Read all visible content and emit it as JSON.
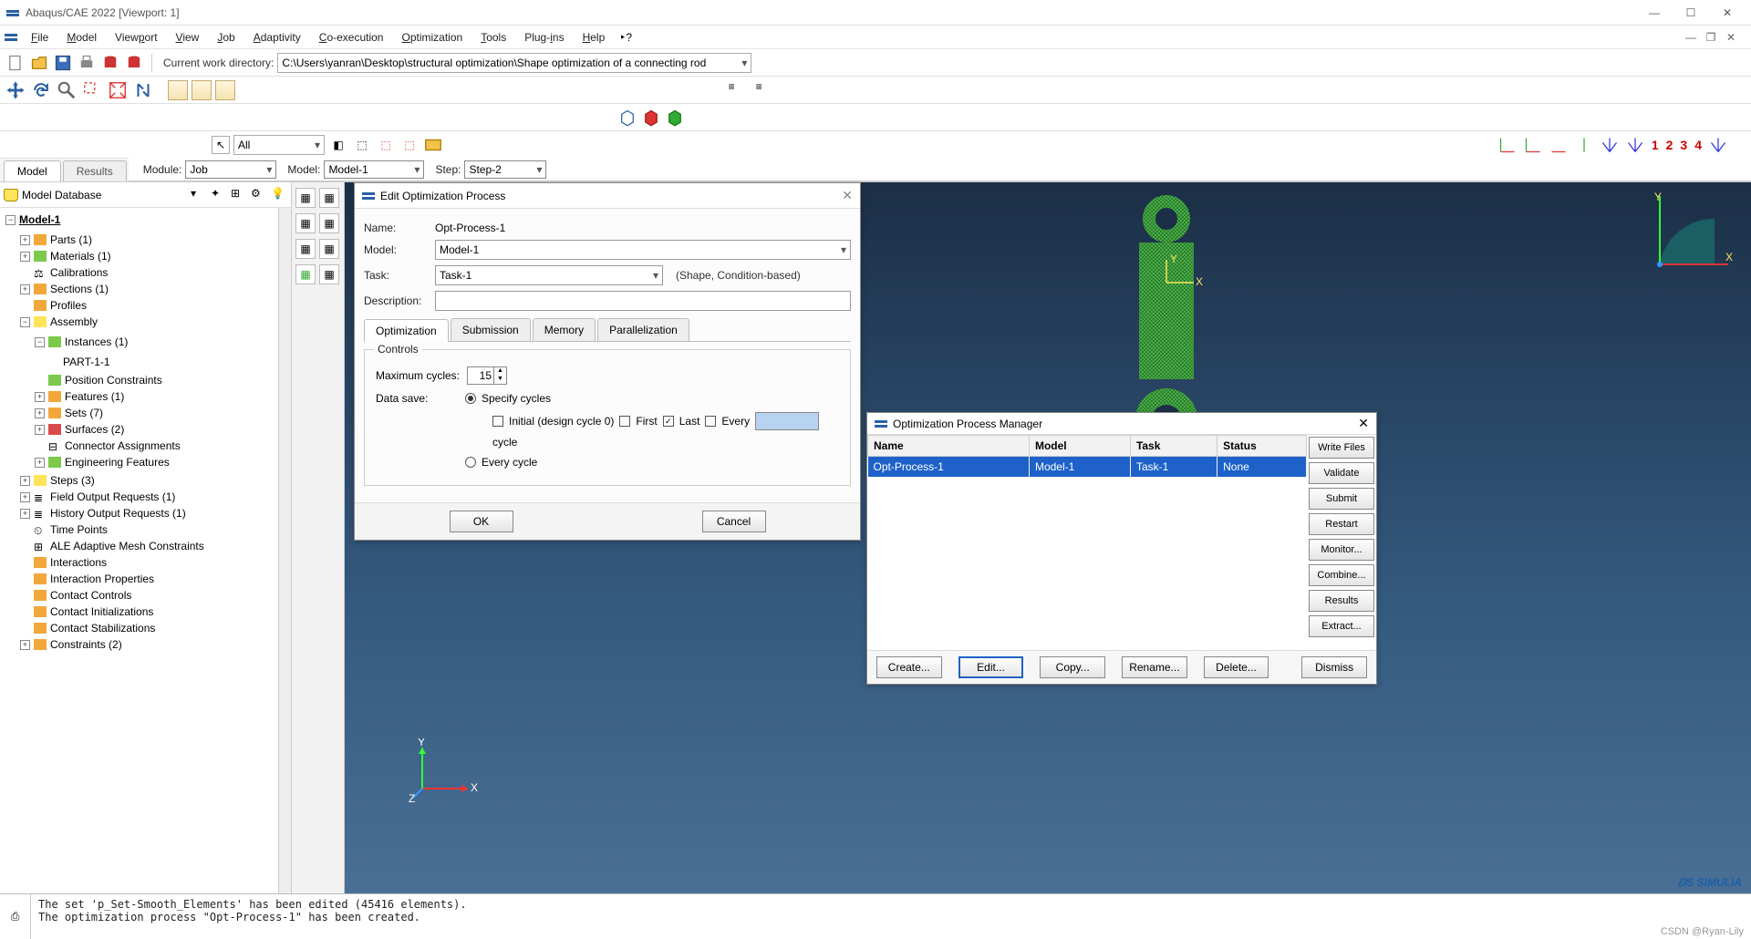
{
  "title": "Abaqus/CAE 2022 [Viewport: 1]",
  "menus": [
    "File",
    "Model",
    "Viewport",
    "View",
    "Job",
    "Adaptivity",
    "Co-execution",
    "Optimization",
    "Tools",
    "Plug-ins",
    "Help"
  ],
  "cwd_label": "Current work directory:",
  "cwd_path": "C:\\Users\\yanran\\Desktop\\structural optimization\\Shape optimization of a connecting rod",
  "sel_all": "All",
  "csys_nums": [
    "1",
    "2",
    "3",
    "4"
  ],
  "tabs": {
    "model": "Model",
    "results": "Results"
  },
  "module_row": {
    "module_label": "Module:",
    "module_value": "Job",
    "model_label": "Model:",
    "model_value": "Model-1",
    "step_label": "Step:",
    "step_value": "Step-2"
  },
  "db_label": "Model Database",
  "tree": {
    "root": "Model-1",
    "items": [
      "Parts (1)",
      "Materials (1)",
      "Calibrations",
      "Sections (1)",
      "Profiles",
      "Assembly",
      "Instances (1)",
      "PART-1-1",
      "Position Constraints",
      "Features (1)",
      "Sets (7)",
      "Surfaces (2)",
      "Connector Assignments",
      "Engineering Features",
      "Steps (3)",
      "Field Output Requests (1)",
      "History Output Requests (1)",
      "Time Points",
      "ALE Adaptive Mesh Constraints",
      "Interactions",
      "Interaction Properties",
      "Contact Controls",
      "Contact Initializations",
      "Contact Stabilizations",
      "Constraints (2)"
    ]
  },
  "edit_dialog": {
    "title": "Edit Optimization Process",
    "name_label": "Name:",
    "name_value": "Opt-Process-1",
    "model_label": "Model:",
    "model_value": "Model-1",
    "task_label": "Task:",
    "task_value": "Task-1",
    "task_note": "(Shape, Condition-based)",
    "desc_label": "Description:",
    "desc_value": "",
    "tabs": [
      "Optimization",
      "Submission",
      "Memory",
      "Parallelization"
    ],
    "controls_legend": "Controls",
    "max_cycles_label": "Maximum cycles:",
    "max_cycles_value": "15",
    "data_save_label": "Data save:",
    "specify_cycles": "Specify cycles",
    "initial_chk": "Initial (design cycle 0)",
    "first_chk": "First",
    "last_chk": "Last",
    "every_chk": "Every",
    "cycle_suffix": "cycle",
    "every_cycle": "Every cycle",
    "ok": "OK",
    "cancel": "Cancel"
  },
  "mgr_dialog": {
    "title": "Optimization Process Manager",
    "headers": [
      "Name",
      "Model",
      "Task",
      "Status"
    ],
    "row": [
      "Opt-Process-1",
      "Model-1",
      "Task-1",
      "None"
    ],
    "right_buttons": [
      "Write Files",
      "Validate",
      "Submit",
      "Restart",
      "Monitor...",
      "Combine...",
      "Results",
      "Extract..."
    ],
    "bottom_buttons": [
      "Create...",
      "Edit...",
      "Copy...",
      "Rename...",
      "Delete...",
      "Dismiss"
    ]
  },
  "axis_labels": {
    "x": "X",
    "y": "Y",
    "z": "Z"
  },
  "brand": "SIMULIA",
  "attribution": "CSDN @Ryan-Lily",
  "messages": "The set 'p_Set-Smooth_Elements' has been edited (45416 elements).\nThe optimization process \"Opt-Process-1\" has been created."
}
